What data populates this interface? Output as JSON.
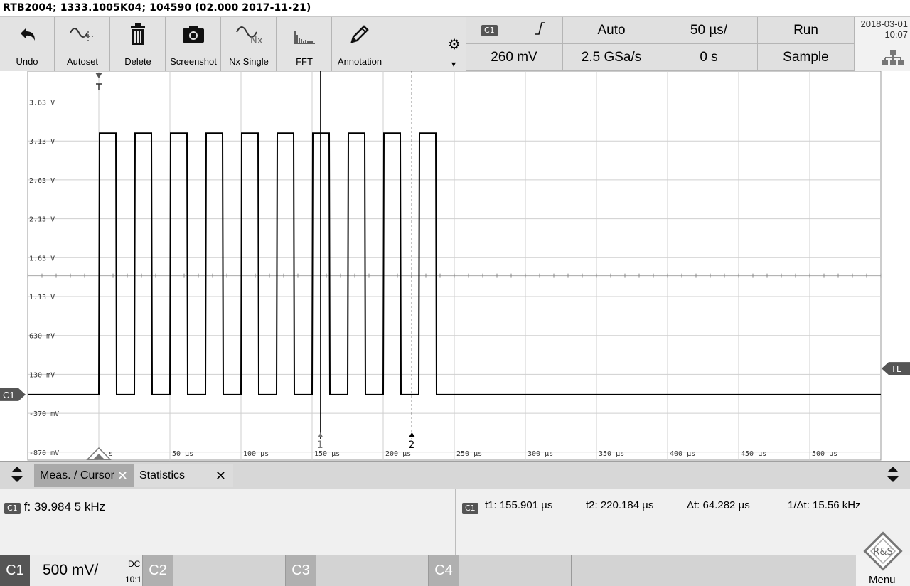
{
  "title": "RTB2004; 1333.1005K04; 104590 (02.000 2017-11-21)",
  "toolbar": {
    "buttons": [
      {
        "label": "Undo",
        "icon": "undo-icon"
      },
      {
        "label": "Autoset",
        "icon": "autoset-icon"
      },
      {
        "label": "Delete",
        "icon": "trash-icon"
      },
      {
        "label": "Screenshot",
        "icon": "camera-icon"
      },
      {
        "label": "Nx Single",
        "icon": "nx-single-icon"
      },
      {
        "label": "FFT",
        "icon": "fft-icon"
      },
      {
        "label": "Annotation",
        "icon": "pencil-icon"
      }
    ]
  },
  "trigger": {
    "channel": "C1",
    "slope_icon": "rising-edge-icon",
    "mode": "Auto",
    "timebase": "50 µs/",
    "run_state": "Run",
    "level": "260 mV",
    "sample_rate": "2.5 GSa/s",
    "offset": "0 s",
    "acq_mode": "Sample"
  },
  "datetime": {
    "date": "2018-03-01",
    "time": "10:07"
  },
  "plot": {
    "channel_marker": "C1",
    "trigger_level_marker": "TL",
    "y_ticks": [
      "3.63 V",
      "3.13 V",
      "2.63 V",
      "2.13 V",
      "1.63 V",
      "1.13 V",
      "630 mV",
      "130 mV",
      "-370 mV",
      "-870 mV"
    ],
    "x_ticks": [
      "s",
      "50 µs",
      "100 µs",
      "150 µs",
      "200 µs",
      "250 µs",
      "300 µs",
      "350 µs",
      "400 µs",
      "450 µs",
      "500 µs"
    ],
    "cursor1_label": "1",
    "cursor2_label": "2",
    "trace_color": "#000000",
    "signal": {
      "high_level_v": 3.23,
      "low_level_v": -0.13,
      "first_rise_us": 0,
      "period_us": 25.0,
      "pulse_width_us": 12.5,
      "pulses": 10
    },
    "cursors_us": [
      155.901,
      220.184
    ]
  },
  "tabs": {
    "meas_cursor": "Meas. / Cursor",
    "statistics": "Statistics"
  },
  "measurements": {
    "freq_chip": "C1",
    "freq": "f: 39.984 5 kHz",
    "cursor_chip": "C1",
    "t1": "t1: 155.901 µs",
    "t2": "t2: 220.184 µs",
    "dt": "Δt: 64.282 µs",
    "inv_dt": "1/Δt: 15.56 kHz"
  },
  "channels": {
    "c1": {
      "label": "C1",
      "scale": "500 mV/",
      "coupling": "DC",
      "probe": "10:1"
    },
    "c2": {
      "label": "C2"
    },
    "c3": {
      "label": "C3"
    },
    "c4": {
      "label": "C4"
    }
  },
  "menu_label": "Menu",
  "logo_text": "R&S"
}
